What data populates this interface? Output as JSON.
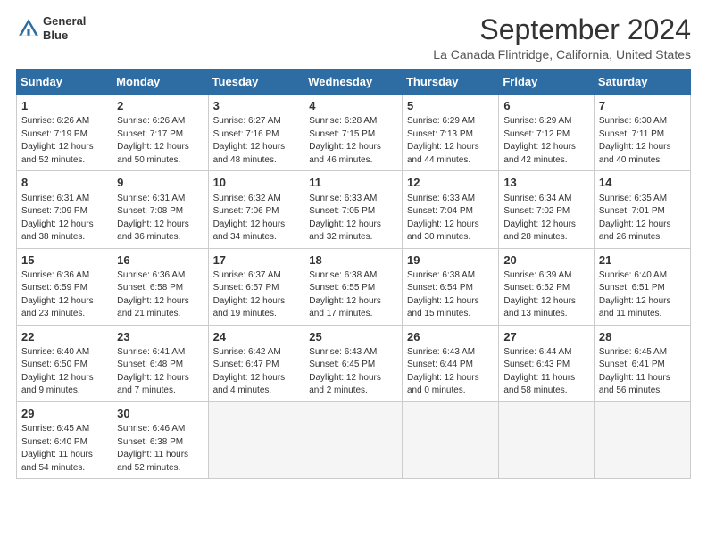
{
  "header": {
    "logo_line1": "General",
    "logo_line2": "Blue",
    "main_title": "September 2024",
    "subtitle": "La Canada Flintridge, California, United States"
  },
  "calendar": {
    "headers": [
      "Sunday",
      "Monday",
      "Tuesday",
      "Wednesday",
      "Thursday",
      "Friday",
      "Saturday"
    ],
    "weeks": [
      [
        {
          "num": "",
          "empty": true
        },
        {
          "num": "",
          "empty": true
        },
        {
          "num": "",
          "empty": true
        },
        {
          "num": "",
          "empty": true
        },
        {
          "num": "",
          "empty": true
        },
        {
          "num": "",
          "empty": true
        },
        {
          "num": "",
          "empty": true
        }
      ],
      [
        {
          "num": "1",
          "sunrise": "6:26 AM",
          "sunset": "7:19 PM",
          "daylight": "12 hours and 52 minutes."
        },
        {
          "num": "2",
          "sunrise": "6:26 AM",
          "sunset": "7:17 PM",
          "daylight": "12 hours and 50 minutes."
        },
        {
          "num": "3",
          "sunrise": "6:27 AM",
          "sunset": "7:16 PM",
          "daylight": "12 hours and 48 minutes."
        },
        {
          "num": "4",
          "sunrise": "6:28 AM",
          "sunset": "7:15 PM",
          "daylight": "12 hours and 46 minutes."
        },
        {
          "num": "5",
          "sunrise": "6:29 AM",
          "sunset": "7:13 PM",
          "daylight": "12 hours and 44 minutes."
        },
        {
          "num": "6",
          "sunrise": "6:29 AM",
          "sunset": "7:12 PM",
          "daylight": "12 hours and 42 minutes."
        },
        {
          "num": "7",
          "sunrise": "6:30 AM",
          "sunset": "7:11 PM",
          "daylight": "12 hours and 40 minutes."
        }
      ],
      [
        {
          "num": "8",
          "sunrise": "6:31 AM",
          "sunset": "7:09 PM",
          "daylight": "12 hours and 38 minutes."
        },
        {
          "num": "9",
          "sunrise": "6:31 AM",
          "sunset": "7:08 PM",
          "daylight": "12 hours and 36 minutes."
        },
        {
          "num": "10",
          "sunrise": "6:32 AM",
          "sunset": "7:06 PM",
          "daylight": "12 hours and 34 minutes."
        },
        {
          "num": "11",
          "sunrise": "6:33 AM",
          "sunset": "7:05 PM",
          "daylight": "12 hours and 32 minutes."
        },
        {
          "num": "12",
          "sunrise": "6:33 AM",
          "sunset": "7:04 PM",
          "daylight": "12 hours and 30 minutes."
        },
        {
          "num": "13",
          "sunrise": "6:34 AM",
          "sunset": "7:02 PM",
          "daylight": "12 hours and 28 minutes."
        },
        {
          "num": "14",
          "sunrise": "6:35 AM",
          "sunset": "7:01 PM",
          "daylight": "12 hours and 26 minutes."
        }
      ],
      [
        {
          "num": "15",
          "sunrise": "6:36 AM",
          "sunset": "6:59 PM",
          "daylight": "12 hours and 23 minutes."
        },
        {
          "num": "16",
          "sunrise": "6:36 AM",
          "sunset": "6:58 PM",
          "daylight": "12 hours and 21 minutes."
        },
        {
          "num": "17",
          "sunrise": "6:37 AM",
          "sunset": "6:57 PM",
          "daylight": "12 hours and 19 minutes."
        },
        {
          "num": "18",
          "sunrise": "6:38 AM",
          "sunset": "6:55 PM",
          "daylight": "12 hours and 17 minutes."
        },
        {
          "num": "19",
          "sunrise": "6:38 AM",
          "sunset": "6:54 PM",
          "daylight": "12 hours and 15 minutes."
        },
        {
          "num": "20",
          "sunrise": "6:39 AM",
          "sunset": "6:52 PM",
          "daylight": "12 hours and 13 minutes."
        },
        {
          "num": "21",
          "sunrise": "6:40 AM",
          "sunset": "6:51 PM",
          "daylight": "12 hours and 11 minutes."
        }
      ],
      [
        {
          "num": "22",
          "sunrise": "6:40 AM",
          "sunset": "6:50 PM",
          "daylight": "12 hours and 9 minutes."
        },
        {
          "num": "23",
          "sunrise": "6:41 AM",
          "sunset": "6:48 PM",
          "daylight": "12 hours and 7 minutes."
        },
        {
          "num": "24",
          "sunrise": "6:42 AM",
          "sunset": "6:47 PM",
          "daylight": "12 hours and 4 minutes."
        },
        {
          "num": "25",
          "sunrise": "6:43 AM",
          "sunset": "6:45 PM",
          "daylight": "12 hours and 2 minutes."
        },
        {
          "num": "26",
          "sunrise": "6:43 AM",
          "sunset": "6:44 PM",
          "daylight": "12 hours and 0 minutes."
        },
        {
          "num": "27",
          "sunrise": "6:44 AM",
          "sunset": "6:43 PM",
          "daylight": "11 hours and 58 minutes."
        },
        {
          "num": "28",
          "sunrise": "6:45 AM",
          "sunset": "6:41 PM",
          "daylight": "11 hours and 56 minutes."
        }
      ],
      [
        {
          "num": "29",
          "sunrise": "6:45 AM",
          "sunset": "6:40 PM",
          "daylight": "11 hours and 54 minutes."
        },
        {
          "num": "30",
          "sunrise": "6:46 AM",
          "sunset": "6:38 PM",
          "daylight": "11 hours and 52 minutes."
        },
        {
          "num": "",
          "empty": true
        },
        {
          "num": "",
          "empty": true
        },
        {
          "num": "",
          "empty": true
        },
        {
          "num": "",
          "empty": true
        },
        {
          "num": "",
          "empty": true
        }
      ]
    ]
  }
}
